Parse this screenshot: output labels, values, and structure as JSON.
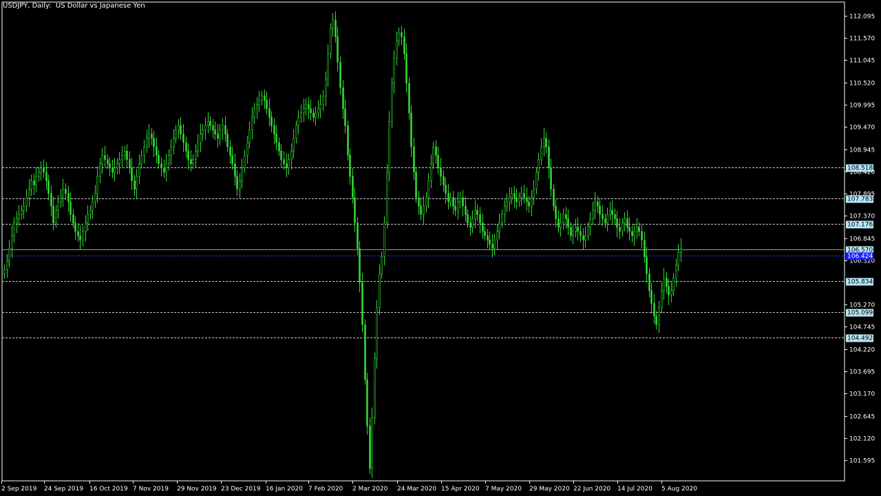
{
  "header": {
    "title": "USDJPY, Daily:  US Dollar vs Japanese Yen"
  },
  "colors": {
    "background": "#000000",
    "candle": "#32d932",
    "axis": "#ffffff",
    "level_line": "#cfcfcf",
    "level_label_bg": "#b8e6f7",
    "bid_line": "#9c9c9c",
    "ask_line": "#1a3cff",
    "ask_label_bg": "#1a1aff"
  },
  "chart_data": {
    "type": "candlestick",
    "symbol": "USDJPY",
    "timeframe": "Daily",
    "ylim": [
      101.1,
      112.4
    ],
    "y_ticks": [
      "112.095",
      "111.570",
      "111.045",
      "110.520",
      "109.995",
      "109.470",
      "108.945",
      "108.420",
      "107.895",
      "107.370",
      "106.845",
      "106.320",
      "105.270",
      "104.745",
      "104.220",
      "103.695",
      "103.170",
      "102.645",
      "102.120",
      "101.595"
    ],
    "x_ticks": [
      "2 Sep 2019",
      "24 Sep 2019",
      "16 Oct 2019",
      "7 Nov 2019",
      "29 Nov 2019",
      "23 Dec 2019",
      "16 Jan 2020",
      "7 Feb 2020",
      "2 Mar 2020",
      "24 Mar 2020",
      "15 Apr 2020",
      "7 May 2020",
      "29 May 2020",
      "22 Jun 2020",
      "14 Jul 2020",
      "5 Aug 2020"
    ],
    "levels": [
      "108.518",
      "107.783",
      "107.176",
      "105.834",
      "105.099",
      "104.492"
    ],
    "bid": "106.570",
    "ask": "106.424",
    "closes": [
      106.1,
      106.3,
      106.6,
      106.9,
      107.2,
      107.3,
      107.4,
      107.5,
      107.6,
      107.8,
      108.0,
      108.2,
      108.1,
      108.3,
      108.4,
      108.5,
      108.4,
      108.2,
      107.9,
      107.6,
      107.2,
      107.5,
      107.7,
      107.8,
      108.0,
      107.9,
      107.7,
      107.4,
      107.2,
      107.0,
      106.9,
      106.8,
      107.0,
      107.2,
      107.4,
      107.5,
      107.7,
      107.9,
      108.3,
      108.6,
      108.8,
      108.7,
      108.6,
      108.5,
      108.4,
      108.5,
      108.6,
      108.7,
      108.8,
      108.9,
      108.7,
      108.5,
      108.2,
      108.0,
      108.3,
      108.6,
      108.8,
      109.0,
      109.2,
      109.3,
      109.2,
      109.0,
      108.8,
      108.6,
      108.5,
      108.4,
      108.6,
      108.8,
      109.0,
      109.2,
      109.4,
      109.5,
      109.3,
      109.1,
      108.9,
      108.7,
      108.6,
      108.7,
      108.9,
      109.1,
      109.3,
      109.4,
      109.5,
      109.6,
      109.5,
      109.4,
      109.3,
      109.2,
      109.4,
      109.5,
      109.3,
      109.0,
      108.8,
      108.6,
      108.3,
      108.0,
      108.2,
      108.5,
      108.8,
      109.1,
      109.4,
      109.7,
      109.9,
      110.0,
      110.1,
      110.2,
      110.1,
      109.9,
      109.7,
      109.5,
      109.3,
      109.1,
      108.9,
      108.7,
      108.6,
      108.5,
      108.7,
      108.9,
      109.2,
      109.5,
      109.7,
      109.8,
      109.9,
      110.0,
      109.9,
      109.8,
      109.7,
      109.8,
      109.9,
      110.0,
      110.2,
      110.6,
      111.2,
      111.8,
      112.0,
      111.6,
      111.0,
      110.4,
      109.9,
      109.5,
      108.8,
      108.3,
      107.8,
      107.2,
      106.6,
      105.8,
      104.8,
      103.5,
      102.4,
      101.4,
      102.6,
      104.0,
      105.2,
      106.0,
      106.4,
      107.2,
      108.4,
      109.6,
      110.5,
      111.1,
      111.5,
      111.7,
      111.6,
      111.2,
      110.5,
      109.8,
      109.0,
      108.4,
      107.8,
      107.6,
      107.4,
      107.6,
      107.8,
      108.2,
      108.6,
      109.0,
      108.8,
      108.5,
      108.3,
      108.1,
      107.9,
      107.7,
      107.8,
      107.6,
      107.5,
      107.7,
      107.8,
      107.6,
      107.4,
      107.2,
      107.1,
      107.3,
      107.5,
      107.4,
      107.2,
      107.0,
      106.9,
      106.8,
      106.7,
      106.6,
      106.8,
      107.0,
      107.2,
      107.4,
      107.6,
      107.7,
      107.8,
      107.9,
      107.8,
      107.7,
      107.8,
      107.9,
      107.8,
      107.7,
      107.6,
      107.8,
      108.0,
      108.4,
      108.7,
      109.0,
      109.2,
      109.0,
      108.5,
      108.0,
      107.6,
      107.3,
      107.1,
      107.2,
      107.4,
      107.3,
      107.1,
      106.9,
      107.0,
      107.1,
      107.0,
      106.9,
      106.8,
      106.9,
      107.1,
      107.3,
      107.5,
      107.7,
      107.6,
      107.4,
      107.3,
      107.2,
      107.4,
      107.5,
      107.4,
      107.3,
      107.1,
      107.0,
      107.2,
      107.3,
      107.1,
      107.0,
      106.9,
      107.0,
      107.1,
      107.0,
      106.8,
      106.4,
      106.0,
      105.6,
      105.3,
      105.0,
      104.8,
      105.2,
      105.6,
      105.9,
      105.7,
      105.5,
      105.6,
      105.9,
      106.2,
      106.5,
      106.6
    ]
  }
}
